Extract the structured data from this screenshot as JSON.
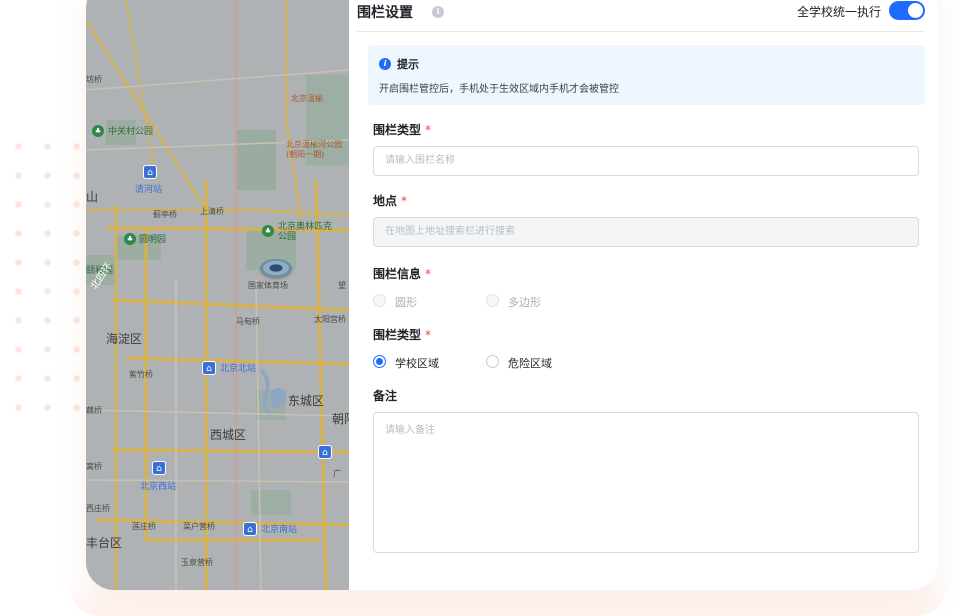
{
  "colors": {
    "primary": "#1f6bff",
    "required": "#f5413f",
    "tip_background": "#eef6ff",
    "map_base": "#aeb2b4"
  },
  "header": {
    "title": "围栏设置",
    "info_icon": "info-icon",
    "global_toggle_label": "全学校统一执行",
    "global_toggle_on": true
  },
  "tip": {
    "icon": "info-filled-icon",
    "title": "提示",
    "text": "开启围栏管控后，手机处于生效区域内手机才会被管控"
  },
  "fields": {
    "fence_name": {
      "label": "围栏类型",
      "required_mark": "*",
      "placeholder": "请输入围栏名称"
    },
    "location": {
      "label": "地点",
      "required_mark": "*",
      "placeholder": "在地图上地址搜索栏进行搜索"
    },
    "fence_info": {
      "label": "围栏信息",
      "required_mark": "*",
      "options": [
        "圆形",
        "多边形"
      ],
      "disabled": true
    },
    "fence_type": {
      "label": "围栏类型",
      "required_mark": "*",
      "options": [
        "学校区域",
        "危险区域"
      ],
      "selected": "学校区域"
    },
    "remark": {
      "label": "备注",
      "placeholder": "请输入备注"
    }
  },
  "map": {
    "labels": [
      "海淀区",
      "东城区",
      "西城区",
      "丰台区",
      "朝阳",
      "北四环",
      "中关村公园",
      "清河站",
      "圆明园",
      "颐和园",
      "北京奥林匹克公园",
      "国家体育场",
      "北京北站",
      "北京西站",
      "北京南站",
      "北京温榆河公园(朝阳一期)",
      "北京温榆",
      "朝阳",
      "上清桥",
      "蓟亭桥",
      "马甸桥",
      "太阳宫桥",
      "紫竹桥",
      "莲庄桥",
      "菜户营桥",
      "玉泉营桥",
      "望",
      "广",
      "坊桥",
      "山",
      "藕桥",
      "窝桥",
      "西庄桥"
    ]
  }
}
